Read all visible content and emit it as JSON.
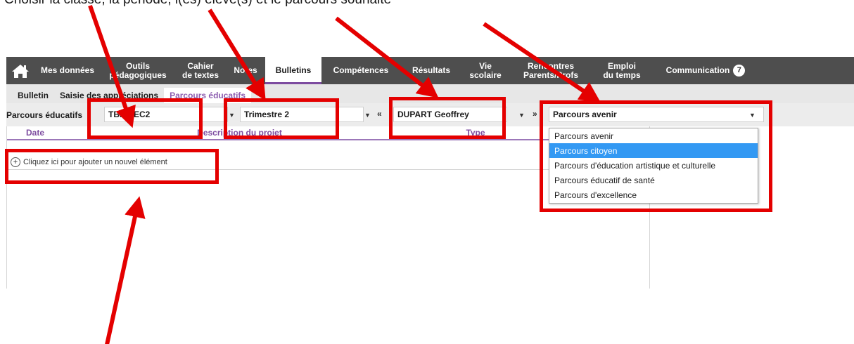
{
  "caption": "Choisir la classe, la période, l(es) élève(s) et le parcours souhaité",
  "nav": {
    "items": [
      {
        "label": "Mes données",
        "active": false
      },
      {
        "label": "Outils\npédagogiques",
        "active": false
      },
      {
        "label": "Cahier\nde textes",
        "active": false
      },
      {
        "label": "Notes",
        "active": false
      },
      {
        "label": "Bulletins",
        "active": true
      },
      {
        "label": "Compétences",
        "active": false
      },
      {
        "label": "Résultats",
        "active": false
      },
      {
        "label": "Vie\nscolaire",
        "active": false
      },
      {
        "label": "Rencontres\nParents/Profs",
        "active": false
      },
      {
        "label": "Emploi\ndu temps",
        "active": false
      },
      {
        "label": "Communication",
        "active": false
      }
    ],
    "communication_badge": "7",
    "home_icon": "home-icon",
    "bar_color": "#4e4e4e",
    "active_accent": "#7d4ca0"
  },
  "subtabs": [
    {
      "label": "Bulletin",
      "active": false
    },
    {
      "label": "Saisie des appréciations",
      "active": false
    },
    {
      "label": "Parcours éducatifs",
      "active": true
    }
  ],
  "toolbar": {
    "label": "Parcours éducatifs",
    "classe": "TBIOTEC2",
    "periode": "Trimestre 2",
    "eleve": "DUPART Geoffrey",
    "parcours": "Parcours avenir"
  },
  "table": {
    "headers": [
      "Date",
      "Description du projet",
      "Type"
    ],
    "add_row_label": "Cliquez ici pour ajouter un nouvel élément"
  },
  "dropdown": {
    "options": [
      {
        "label": "Parcours avenir",
        "selected": false
      },
      {
        "label": "Parcours citoyen",
        "selected": true
      },
      {
        "label": "Parcours d'éducation artistique et culturelle",
        "selected": false
      },
      {
        "label": "Parcours éducatif de santé",
        "selected": false
      },
      {
        "label": "Parcours d'excellence",
        "selected": false
      }
    ],
    "highlight_color": "#3399f3"
  },
  "annotation_color": "#e40000"
}
